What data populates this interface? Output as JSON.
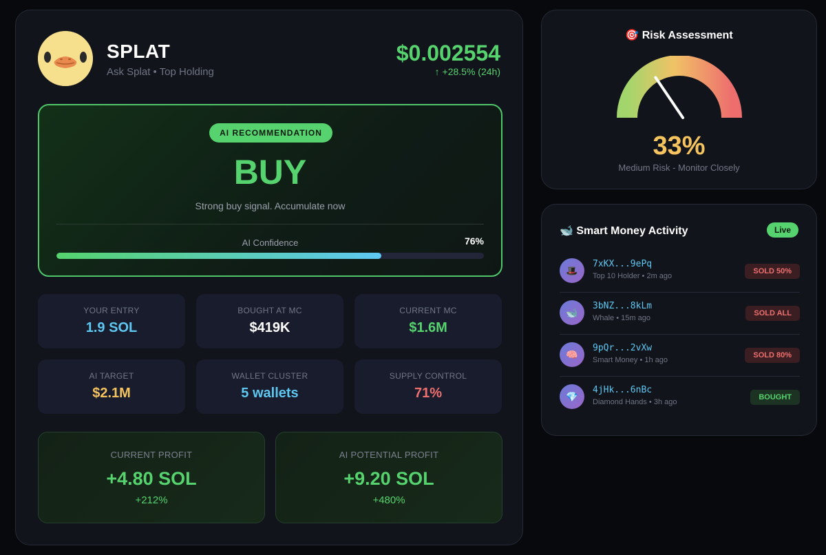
{
  "token": {
    "name": "SPLAT",
    "subtitle": "Ask Splat • Top Holding",
    "price": "$0.002554",
    "change": "↑ +28.5% (24h)"
  },
  "recommendation": {
    "pill": "AI RECOMMENDATION",
    "value": "BUY",
    "description": "Strong buy signal. Accumulate now",
    "confidence_label": "AI Confidence",
    "confidence_value": "76%",
    "confidence_fraction": 0.76
  },
  "stats": [
    {
      "label": "YOUR ENTRY",
      "value": "1.9 SOL",
      "color": "#5ec8f2"
    },
    {
      "label": "BOUGHT AT MC",
      "value": "$419K",
      "color": "#ffffff"
    },
    {
      "label": "CURRENT MC",
      "value": "$1.6M",
      "color": "#56d36e"
    },
    {
      "label": "AI TARGET",
      "value": "$2.1M",
      "color": "#f5c45f"
    },
    {
      "label": "WALLET CLUSTER",
      "value": "5 wallets",
      "color": "#5ec8f2"
    },
    {
      "label": "SUPPLY CONTROL",
      "value": "71%",
      "color": "#f07070"
    }
  ],
  "profits": [
    {
      "label": "CURRENT PROFIT",
      "value": "+4.80 SOL",
      "pct": "+212%"
    },
    {
      "label": "AI POTENTIAL PROFIT",
      "value": "+9.20 SOL",
      "pct": "+480%"
    }
  ],
  "risk": {
    "icon": "🎯",
    "title": "Risk Assessment",
    "value": "33%",
    "fraction": 0.33,
    "description": "Medium Risk - Monitor Closely"
  },
  "smart_money": {
    "icon": "🐋",
    "title": "Smart Money Activity",
    "live": "Live",
    "wallets": [
      {
        "icon": "🎩",
        "address": "7xKX...9ePq",
        "meta": "Top 10 Holder • 2m ago",
        "action": "SOLD 50%",
        "type": "sell"
      },
      {
        "icon": "🐋",
        "address": "3bNZ...8kLm",
        "meta": "Whale • 15m ago",
        "action": "SOLD ALL",
        "type": "sell"
      },
      {
        "icon": "🧠",
        "address": "9pQr...2vXw",
        "meta": "Smart Money • 1h ago",
        "action": "SOLD 80%",
        "type": "sell"
      },
      {
        "icon": "💎",
        "address": "4jHk...6nBc",
        "meta": "Diamond Hands • 3h ago",
        "action": "BOUGHT",
        "type": "buy"
      }
    ]
  }
}
